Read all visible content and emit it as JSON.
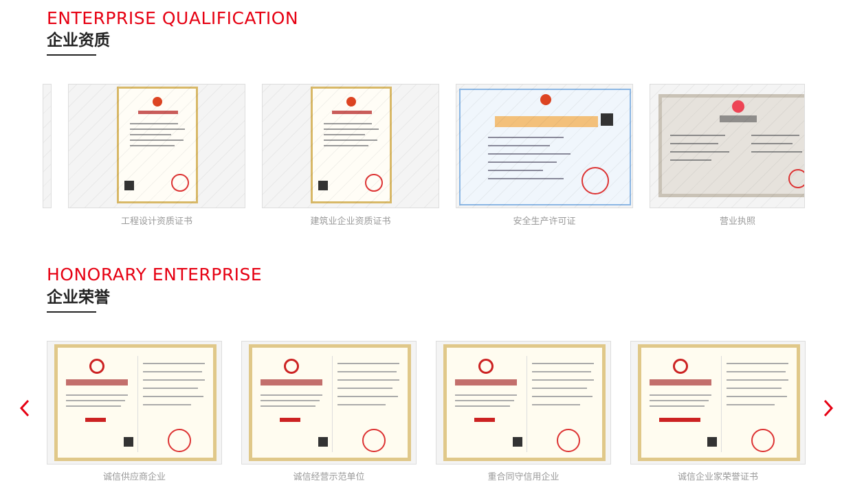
{
  "qualification": {
    "title_en": "ENTERPRISE QUALIFICATION",
    "title_cn": "企业资质",
    "items": [
      {
        "caption": "工程设计资质证书"
      },
      {
        "caption": "建筑业企业资质证书"
      },
      {
        "caption": "安全生产许可证"
      },
      {
        "caption": "营业执照"
      }
    ]
  },
  "honor": {
    "title_en": "HONORARY ENTERPRISE",
    "title_cn": "企业荣誉",
    "items": [
      {
        "caption": "诚信供应商企业"
      },
      {
        "caption": "诚信经营示范单位"
      },
      {
        "caption": "重合同守信用企业"
      },
      {
        "caption": "诚信企业家荣誉证书"
      }
    ]
  },
  "colors": {
    "accent": "#e60012",
    "heading": "#222222",
    "caption": "#999999"
  },
  "icons": {
    "prev": "chevron-left-icon",
    "next": "chevron-right-icon"
  }
}
